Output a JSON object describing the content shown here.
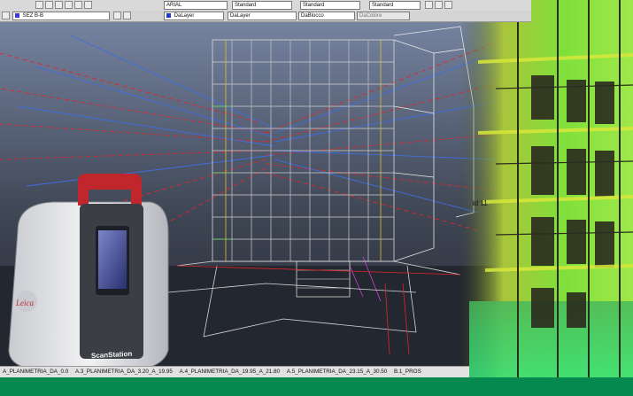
{
  "toolbar": {
    "font_name": "ARIAL",
    "text_style": "Standard",
    "dim_style": "Standard",
    "table_style": "Standard",
    "multileader_style": "Standard",
    "layer_name": "SEZ B-B",
    "color_layer": "DaLayer",
    "linetype": "DaLayer",
    "lineweight": "DaBlocco",
    "plot_style": "DaColore"
  },
  "layout_tabs": [
    "A_PLANIMETRIA_DA_0.0",
    "A.3_PLANIMETRIA_DA_3.20_A_19.95",
    "A.4_PLANIMETRIA_DA_19.95_A_21.80",
    "A.5_PLANIMETRIA_DA_23.15_A_30.50",
    "B.1_PROS"
  ],
  "scanner": {
    "brand": "ScanStation"
  },
  "pointcloud_tag": "id 11",
  "colors": {
    "accent_green": "#06894e",
    "scanner_red": "#c0262c",
    "wire_red": "#e0252b",
    "wire_blue": "#3f6de0",
    "cloud_green": "#6ee02a",
    "cloud_yellow": "#d8e83a"
  },
  "icons": [
    "new-icon",
    "open-icon",
    "save-icon",
    "undo-icon",
    "redo-icon",
    "pan-icon",
    "zoom-icon",
    "layer-icon",
    "color-icon"
  ]
}
